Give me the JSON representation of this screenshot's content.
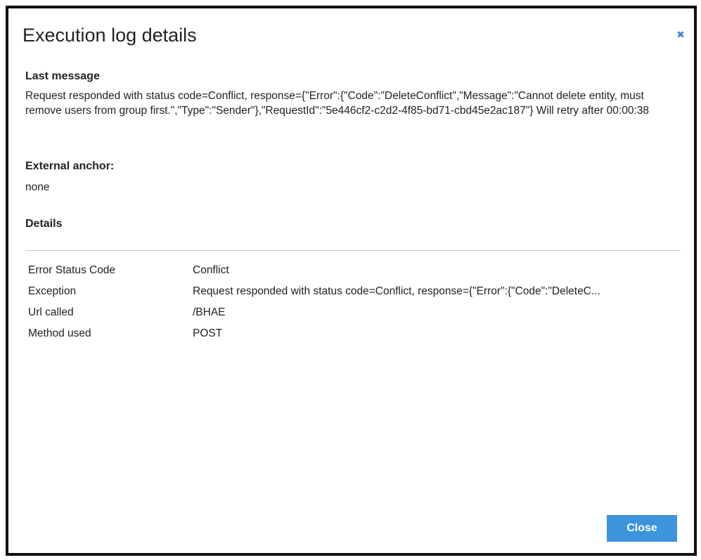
{
  "dialog": {
    "title": "Execution log details",
    "close_icon": "close-icon",
    "close_glyph": "✖"
  },
  "last_message": {
    "heading": "Last message",
    "text": "Request responded with status code=Conflict, response={\"Error\":{\"Code\":\"DeleteConflict\",\"Message\":\"Cannot delete entity, must remove users from group first.\",\"Type\":\"Sender\"},\"RequestId\":\"5e446cf2-c2d2-4f85-bd71-cbd45e2ac187\"} Will retry after 00:00:38"
  },
  "external_anchor": {
    "heading": "External anchor:",
    "value": "none"
  },
  "details": {
    "heading": "Details",
    "rows": [
      {
        "key": "Error Status Code",
        "value": "Conflict"
      },
      {
        "key": "Exception",
        "value": "Request responded with status code=Conflict, response={\"Error\":{\"Code\":\"DeleteC..."
      },
      {
        "key": "Url called",
        "value": "/BHAE"
      },
      {
        "key": "Method used",
        "value": "POST"
      }
    ]
  },
  "footer": {
    "close_label": "Close"
  },
  "colors": {
    "accent": "#3b94dc",
    "close_icon": "#4a86c8",
    "border": "#111111",
    "divider": "#cccccc"
  }
}
